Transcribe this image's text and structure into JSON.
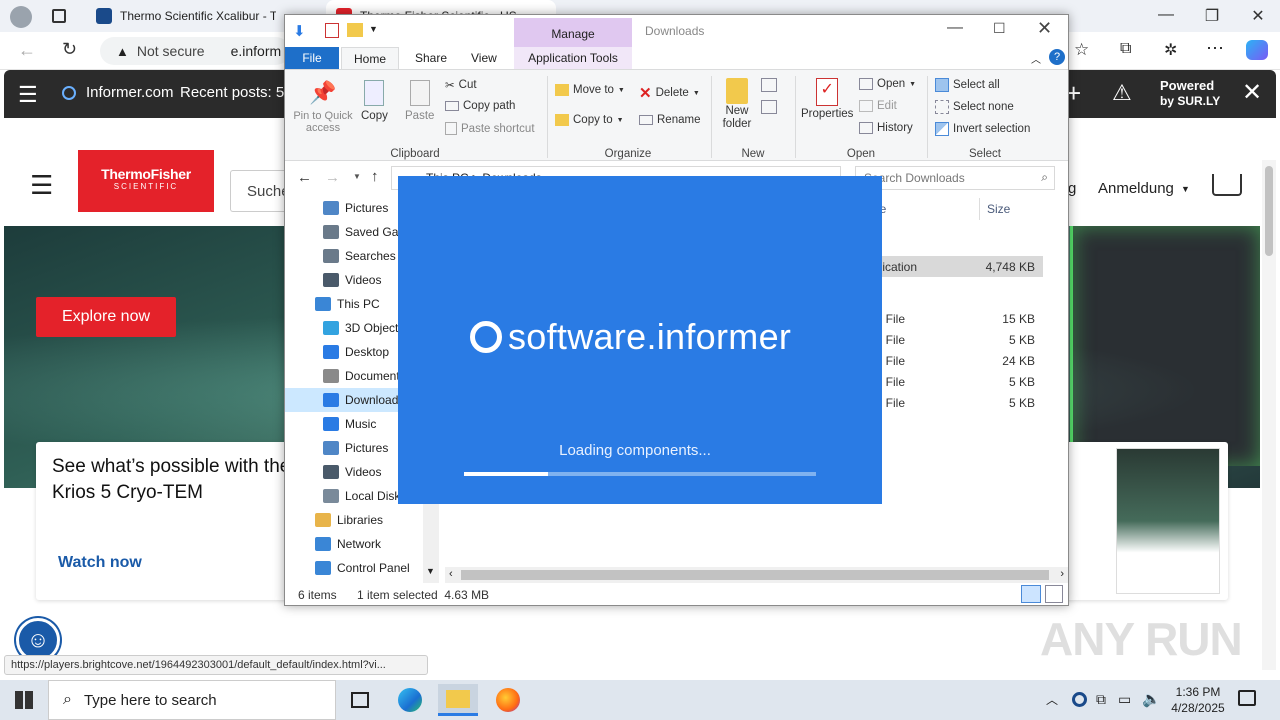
{
  "browser": {
    "tabs": [
      {
        "label": "Thermo Scientific Xcalibur - Th",
        "active": false
      },
      {
        "label": "Thermo Fisher Scientific - US",
        "active": true
      }
    ],
    "url_warning": "Not secure",
    "url_text": "e.inform",
    "win_controls": [
      "—",
      "❐",
      "✕"
    ]
  },
  "informer_bar": {
    "site": "Informer.com",
    "recent": "Recent posts: 5",
    "powered_line1": "Powered",
    "powered_line2": "by SUR.LY"
  },
  "page": {
    "search_placeholder": "Suche",
    "nav_right_1": "g",
    "nav_right_2": "Anmeldung",
    "logo_line1": "ThermoFisher",
    "logo_line2": "SCIENTIFIC",
    "explore_button": "Explore now",
    "card_title": "See what’s possible with the Krios 5 Cryo-TEM",
    "watch_now": "Watch now",
    "status_link": "https://players.brightcove.net/1964492303001/default_default/index.html?vi..."
  },
  "explorer": {
    "title": "Downloads",
    "manage_tab": "Manage",
    "tabs": [
      "File",
      "Home",
      "Share",
      "View",
      "Application Tools"
    ],
    "clipboard": {
      "pin": "Pin to Quick access",
      "copy": "Copy",
      "paste": "Paste",
      "cut": "Cut",
      "copy_path": "Copy path",
      "paste_shortcut": "Paste shortcut",
      "label": "Clipboard"
    },
    "organize": {
      "move_to": "Move to",
      "copy_to": "Copy to",
      "delete": "Delete",
      "rename": "Rename",
      "label": "Organize"
    },
    "new": {
      "new_folder_1": "New",
      "new_folder_2": "folder",
      "label": "New"
    },
    "open": {
      "properties": "Properties",
      "open": "Open",
      "edit": "Edit",
      "history": "History",
      "label": "Open"
    },
    "select": {
      "select_all": "Select all",
      "select_none": "Select none",
      "invert": "Invert selection",
      "label": "Select"
    },
    "address": "This PC  >  Downloads",
    "search_placeholder": "Search Downloads",
    "nav_items": [
      {
        "label": "Pictures",
        "color": "#4f86c6"
      },
      {
        "label": "Saved Games",
        "color": "#6a7a8a"
      },
      {
        "label": "Searches",
        "color": "#6a7a8a"
      },
      {
        "label": "Videos",
        "color": "#4a5a6a"
      },
      {
        "label": "This PC",
        "color": "#3a86d6"
      },
      {
        "label": "3D Objects",
        "color": "#33a3e0"
      },
      {
        "label": "Desktop",
        "color": "#2a7be4"
      },
      {
        "label": "Documents",
        "color": "#8a8a8a"
      },
      {
        "label": "Downloads",
        "color": "#2a7be4"
      },
      {
        "label": "Music",
        "color": "#2a7be4"
      },
      {
        "label": "Pictures",
        "color": "#4f86c6"
      },
      {
        "label": "Videos",
        "color": "#4a5a6a"
      },
      {
        "label": "Local Disk",
        "color": "#7a8a9a"
      },
      {
        "label": "Libraries",
        "color": "#e8b44a"
      },
      {
        "label": "Network",
        "color": "#3a86d6"
      },
      {
        "label": "Control Panel",
        "color": "#3a86d6"
      }
    ],
    "col_type": "pe",
    "col_size": "Size",
    "files": [
      {
        "type": "plication",
        "size": "4,748 KB"
      },
      {
        "type": "G File",
        "size": "15 KB"
      },
      {
        "type": "G File",
        "size": "5 KB"
      },
      {
        "type": "G File",
        "size": "24 KB"
      },
      {
        "type": "G File",
        "size": "5 KB"
      },
      {
        "type": "G File",
        "size": "5 KB"
      }
    ],
    "status_items": "6 items",
    "status_selected": "1 item selected  4.63 MB"
  },
  "splash": {
    "brand": "software.informer",
    "loading": "Loading components...",
    "progress": 0.24
  },
  "taskbar": {
    "search_placeholder": "Type here to search",
    "time": "1:36 PM",
    "date": "4/28/2025"
  },
  "watermark": "ANY RUN"
}
